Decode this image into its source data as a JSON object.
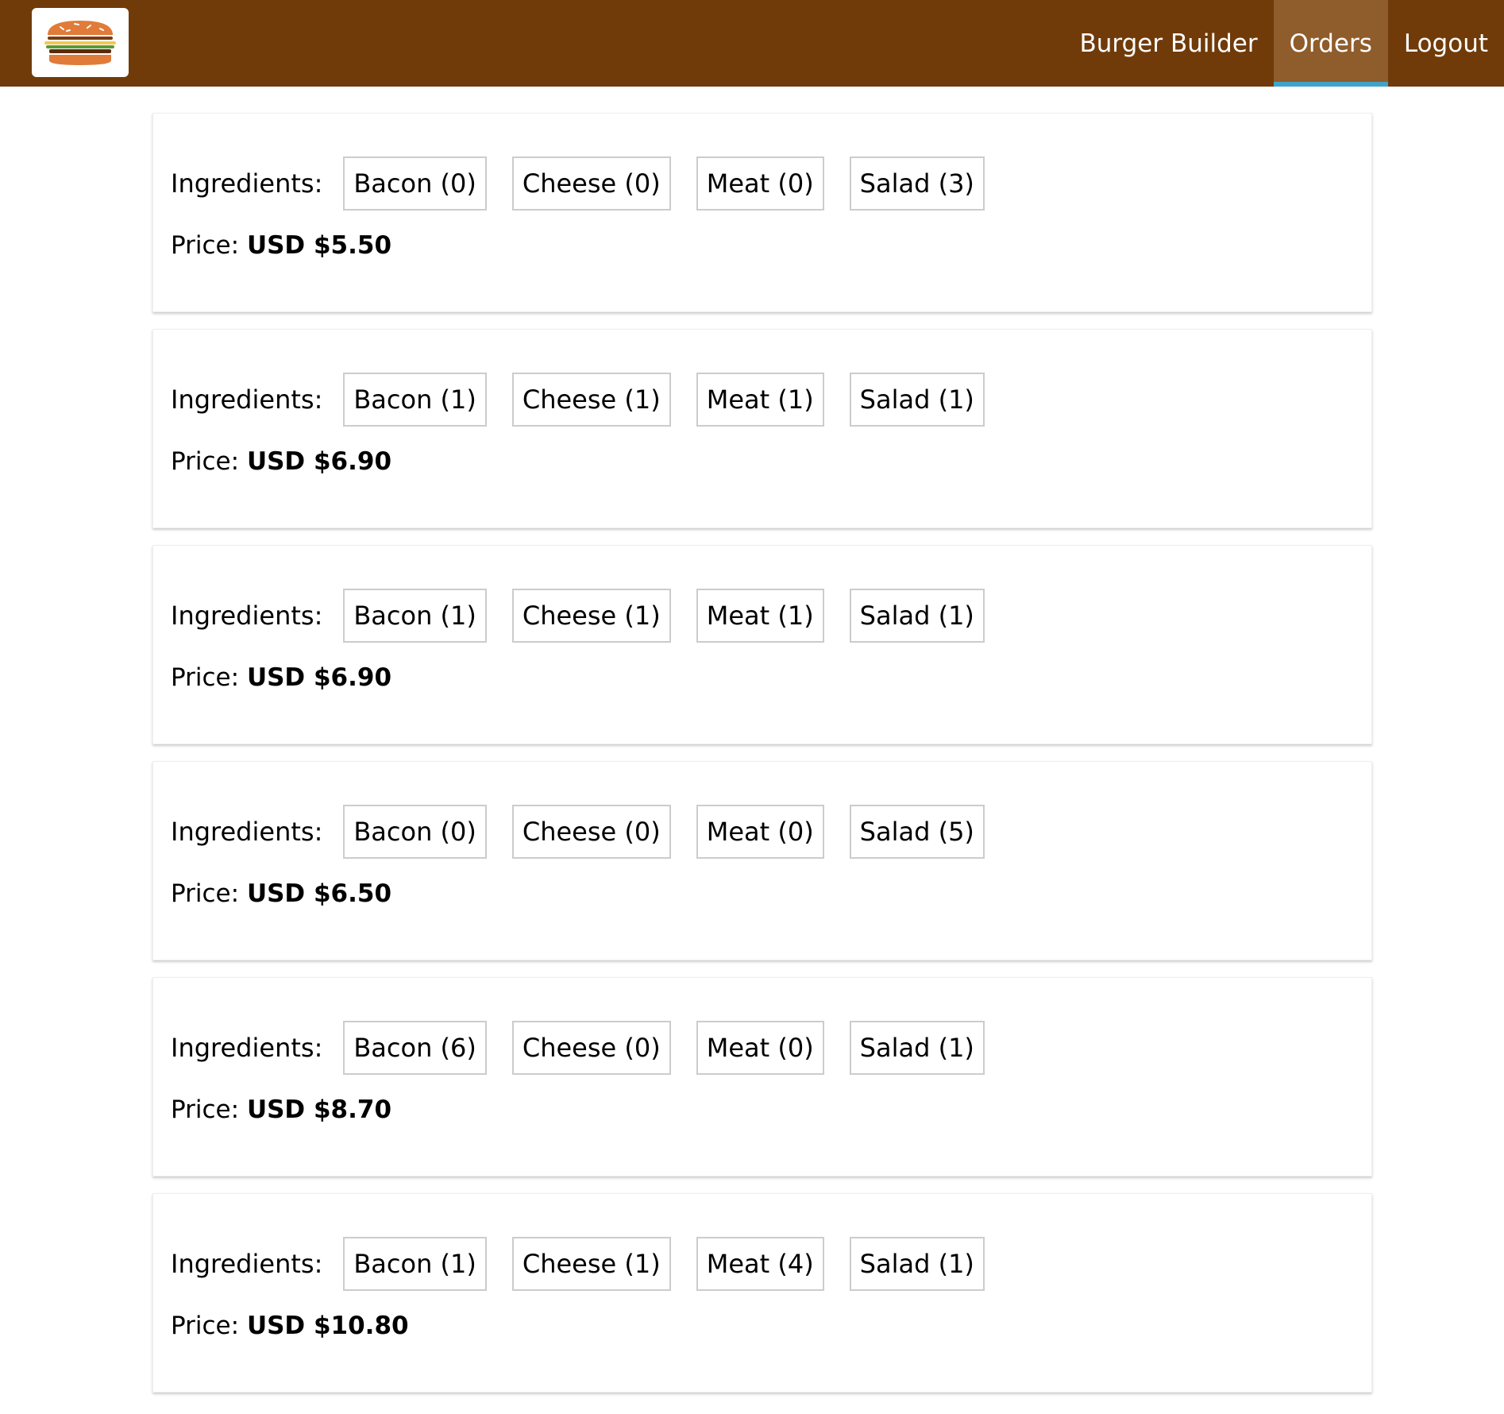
{
  "colors": {
    "toolbar_bg": "#703b09",
    "nav_active_bg": "#8f5c2c",
    "nav_active_underline": "#40a4c8"
  },
  "logo": {
    "icon": "burger-logo-icon"
  },
  "nav": {
    "items": [
      {
        "label": "Burger Builder",
        "active": false
      },
      {
        "label": "Orders",
        "active": true
      },
      {
        "label": "Logout",
        "active": false
      }
    ]
  },
  "orders": [
    {
      "ingredients_label": "Ingredients:",
      "ingredients": [
        "Bacon (0)",
        "Cheese (0)",
        "Meat (0)",
        "Salad (3)"
      ],
      "price_label": "Price:",
      "price": "USD $5.50"
    },
    {
      "ingredients_label": "Ingredients:",
      "ingredients": [
        "Bacon (1)",
        "Cheese (1)",
        "Meat (1)",
        "Salad (1)"
      ],
      "price_label": "Price:",
      "price": "USD $6.90"
    },
    {
      "ingredients_label": "Ingredients:",
      "ingredients": [
        "Bacon (1)",
        "Cheese (1)",
        "Meat (1)",
        "Salad (1)"
      ],
      "price_label": "Price:",
      "price": "USD $6.90"
    },
    {
      "ingredients_label": "Ingredients:",
      "ingredients": [
        "Bacon (0)",
        "Cheese (0)",
        "Meat (0)",
        "Salad (5)"
      ],
      "price_label": "Price:",
      "price": "USD $6.50"
    },
    {
      "ingredients_label": "Ingredients:",
      "ingredients": [
        "Bacon (6)",
        "Cheese (0)",
        "Meat (0)",
        "Salad (1)"
      ],
      "price_label": "Price:",
      "price": "USD $8.70"
    },
    {
      "ingredients_label": "Ingredients:",
      "ingredients": [
        "Bacon (1)",
        "Cheese (1)",
        "Meat (4)",
        "Salad (1)"
      ],
      "price_label": "Price:",
      "price": "USD $10.80"
    }
  ]
}
